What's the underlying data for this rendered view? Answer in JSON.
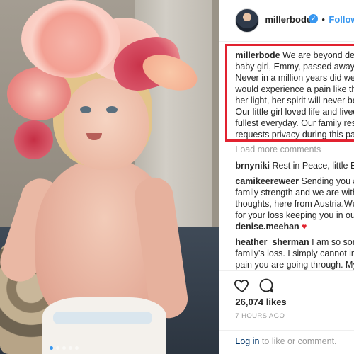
{
  "photo": {
    "alt": "photo",
    "carousel_dots": 5,
    "active_dot": 1
  },
  "header": {
    "username": "millerbode",
    "verified_badge": "verified-badge-icon",
    "separator": "•",
    "follow_label": "Follow"
  },
  "caption": {
    "username": "millerbode",
    "lines": [
      "We are beyond deva",
      "baby girl, Emmy, passed away ye",
      "Never in a million years did we t",
      "would experience a pain like this",
      "her light, her spirit will never be",
      "Our little girl loved life and lived",
      "fullest everyday. Our family respe",
      "requests privacy during this pain"
    ],
    "highlight_color": "#e22230"
  },
  "load_more": "Load more comments",
  "comments": [
    {
      "username": "brnyniki",
      "lines": [
        "Rest in Peace, little Emm"
      ]
    },
    {
      "username": "camikeereweer",
      "lines": [
        "Sending you and",
        "family strength and we are with y",
        "thoughts, here from Austria.We a",
        "for your loss keeping you in our"
      ]
    },
    {
      "username": "denise.meehan",
      "lines": [
        ""
      ],
      "emoji": "♥"
    },
    {
      "username": "heather_sherman",
      "lines": [
        "I am so sorry t",
        "family's loss. I simply cannot ima",
        "pain you are going through. My"
      ]
    }
  ],
  "actions": {
    "like_icon": "heart-icon",
    "comment_icon": "comment-icon",
    "likes": "26,074 likes",
    "time": "7 HOURS AGO",
    "login_link": "Log in",
    "login_rest": "to like or comment."
  },
  "colors": {
    "accent": "#3897f0",
    "text": "#262626",
    "muted": "#999999",
    "link_dark": "#003569"
  }
}
